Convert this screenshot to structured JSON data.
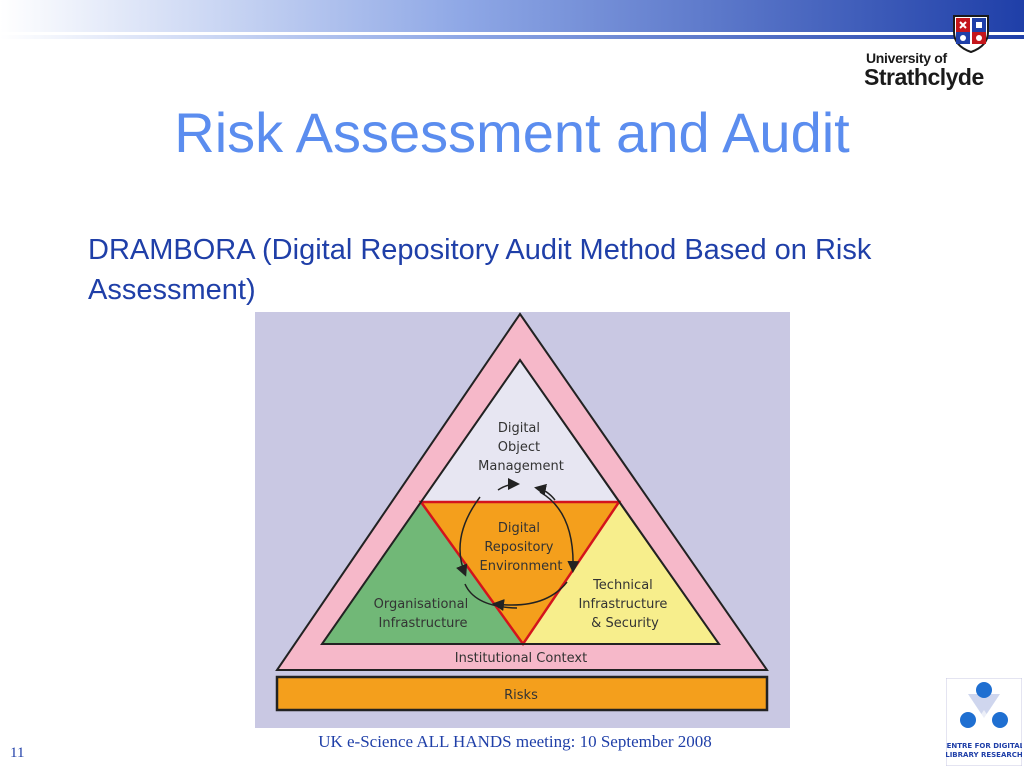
{
  "slide": {
    "title": "Risk Assessment and Audit",
    "subtitle": "DRAMBORA (Digital Repository Audit Method Based on Risk Assessment)",
    "footer": "UK e-Science ALL HANDS meeting: 10 September 2008",
    "page_number": "11"
  },
  "logo": {
    "university_line1": "University of",
    "university_line2": "Strathclyde",
    "cdlr_line1": "CENTRE FOR DIGITAL",
    "cdlr_line2": "LIBRARY RESEARCH"
  },
  "diagram": {
    "dom_line1": "Digital",
    "dom_line2": "Object",
    "dom_line3": "Management",
    "dre_line1": "Digital",
    "dre_line2": "Repository",
    "dre_line3": "Environment",
    "org_line1": "Organisational",
    "org_line2": "Infrastructure",
    "tech_line1": "Technical",
    "tech_line2": "Infrastructure",
    "tech_line3": "& Security",
    "institutional_context": "Institutional Context",
    "risks": "Risks"
  },
  "colors": {
    "title": "#5b8def",
    "body_text": "#1f3fa8",
    "header_band": "#1f3fa8",
    "diagram_background": "#c9c8e3",
    "outer_triangle": "#f6b8c9",
    "dom_section": "#e7e6f2",
    "dre_section": "#f49f1c",
    "org_section": "#71b877",
    "tech_section": "#f7ee8c",
    "risks_bar": "#f49f1c"
  }
}
